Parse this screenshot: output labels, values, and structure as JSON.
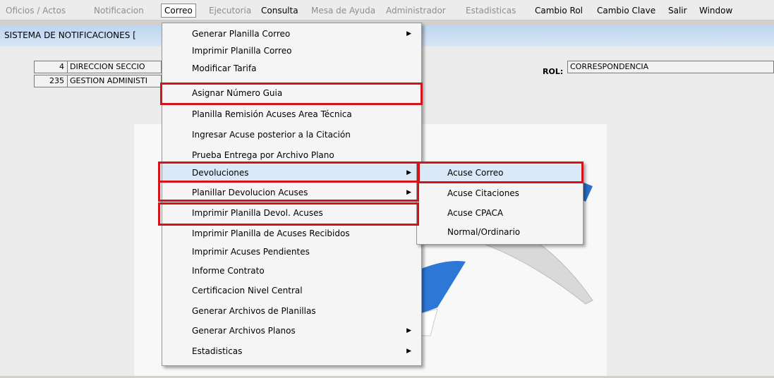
{
  "menubar": {
    "items": [
      {
        "label": "Oficios / Actos",
        "disabled": true
      },
      {
        "label": "Notificacion",
        "disabled": true
      },
      {
        "label": "Correo",
        "disabled": false
      },
      {
        "label": "Ejecutoria",
        "disabled": true
      },
      {
        "label": "Consulta",
        "disabled": false
      },
      {
        "label": "Mesa de Ayuda",
        "disabled": true
      },
      {
        "label": "Administrador",
        "disabled": true
      },
      {
        "label": "Estadisticas",
        "disabled": true
      },
      {
        "label": "Cambio Rol",
        "disabled": false
      },
      {
        "label": "Cambio Clave",
        "disabled": false
      },
      {
        "label": "Salir",
        "disabled": false
      },
      {
        "label": "Window",
        "disabled": false
      }
    ]
  },
  "window": {
    "title": "SISTEMA DE NOTIFICACIONES ["
  },
  "form": {
    "row1_code": "4",
    "row1_name": "DIRECCION SECCIO",
    "row2_code": "235",
    "row2_name": "GESTION ADMINISTI",
    "rol_label": "ROL:",
    "rol_value": "CORRESPONDENCIA"
  },
  "correo_menu": {
    "items": [
      {
        "label": "Generar Planilla Correo",
        "submenu": true
      },
      {
        "label": "Imprimir Planilla Correo",
        "submenu": false
      },
      {
        "label": "Modificar Tarifa",
        "submenu": false
      },
      {
        "label": "Asignar Número Guia",
        "submenu": false
      },
      {
        "label": "Planilla Remisión Acuses Area Técnica",
        "submenu": false
      },
      {
        "label": "Ingresar Acuse posterior a la Citación",
        "submenu": false
      },
      {
        "label": "Prueba Entrega por Archivo Plano",
        "submenu": false
      },
      {
        "label": "Devoluciones",
        "submenu": true
      },
      {
        "label": "Planillar Devolucion Acuses",
        "submenu": true
      },
      {
        "label": "Imprimir Planilla Devol. Acuses",
        "submenu": false
      },
      {
        "label": "Imprimir Planilla de Acuses Recibidos",
        "submenu": false
      },
      {
        "label": "Imprimir Acuses Pendientes",
        "submenu": false
      },
      {
        "label": "Informe Contrato",
        "submenu": false
      },
      {
        "label": "Certificacion Nivel Central",
        "submenu": false
      },
      {
        "label": "Generar Archivos de Planillas",
        "submenu": false
      },
      {
        "label": "Generar Archivos Planos",
        "submenu": true
      },
      {
        "label": "Estadisticas",
        "submenu": true
      }
    ]
  },
  "devoluciones_submenu": {
    "items": [
      "Acuse Correo",
      "Acuse Citaciones",
      "Acuse CPACA",
      "Normal/Ordinario"
    ]
  },
  "colors": {
    "highlight_box": "#d3151b",
    "menu_hover": "#dbe8f7"
  }
}
